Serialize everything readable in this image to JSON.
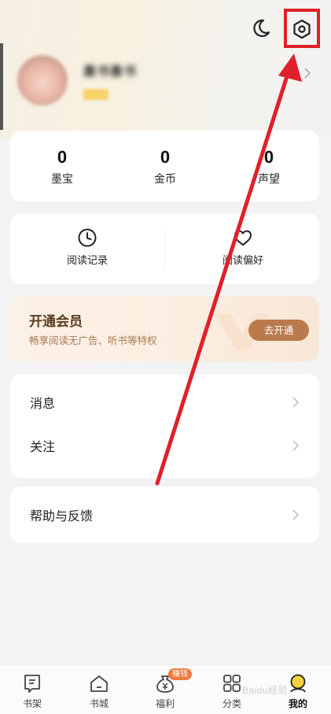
{
  "header": {
    "moon_icon": "moon-icon",
    "settings_icon": "gear-icon",
    "highlight_color": "#e0202a"
  },
  "profile": {
    "nickname": "墨书墨书"
  },
  "stats": [
    {
      "value": "0",
      "label": "墨宝"
    },
    {
      "value": "0",
      "label": "金币"
    },
    {
      "value": "0",
      "label": "声望"
    }
  ],
  "shortcuts": [
    {
      "label": "阅读记录",
      "icon": "clock-icon"
    },
    {
      "label": "阅读偏好",
      "icon": "heart-icon"
    }
  ],
  "vip": {
    "title": "开通会员",
    "subtitle": "畅享阅读无广告、听书等特权",
    "button": "去开通",
    "button_color": "#bb7a4d"
  },
  "menu": [
    {
      "label": "消息"
    },
    {
      "label": "关注"
    }
  ],
  "help": {
    "label": "帮助与反馈"
  },
  "tabbar": {
    "tabs": [
      {
        "label": "书架",
        "icon": "bookshelf-icon"
      },
      {
        "label": "书城",
        "icon": "home-icon"
      },
      {
        "label": "福利",
        "icon": "money-bag-icon"
      },
      {
        "label": "分类",
        "icon": "grid-icon"
      },
      {
        "label": "我的",
        "icon": "profile-icon"
      }
    ],
    "earn_badge": "赚钱",
    "active": "我的"
  },
  "watermark": "Baidu经验"
}
